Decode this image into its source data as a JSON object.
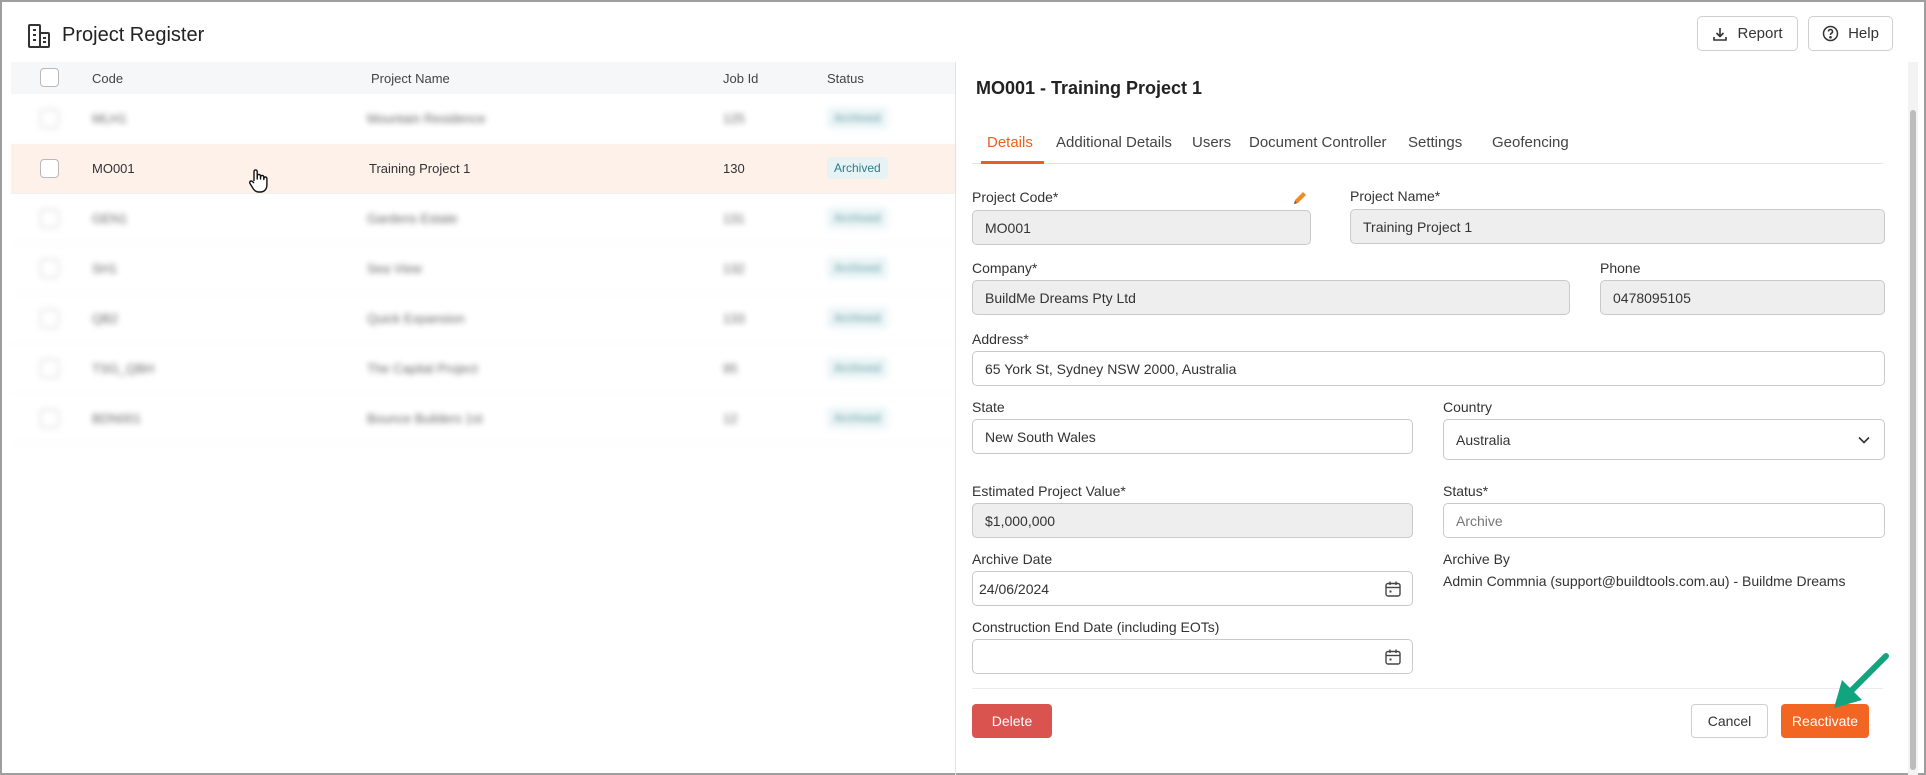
{
  "header": {
    "title": "Project Register",
    "report_label": "Report",
    "help_label": "Help",
    "icons": {
      "logo": "building-icon",
      "report": "download-icon",
      "help": "help-circle-icon"
    }
  },
  "list": {
    "columns": [
      "Code",
      "Project Name",
      "Job Id",
      "Status"
    ],
    "rows": [
      {
        "code": "MLH1",
        "name": "Mountain Residence",
        "job_id": "125",
        "status": "Archived",
        "blurred": true
      },
      {
        "code": "MO001",
        "name": "Training Project 1",
        "job_id": "130",
        "status": "Archived",
        "blurred": false,
        "selected": true
      },
      {
        "code": "GEN1",
        "name": "Gardens Estate",
        "job_id": "131",
        "status": "Archived",
        "blurred": true
      },
      {
        "code": "SH1",
        "name": "Sea View",
        "job_id": "132",
        "status": "Archived",
        "blurred": true
      },
      {
        "code": "QB2",
        "name": "Quick Expansion",
        "job_id": "133",
        "status": "Archived",
        "blurred": true
      },
      {
        "code": "TSG_QBH",
        "name": "The Capital Project",
        "job_id": "95",
        "status": "Archived",
        "blurred": true
      },
      {
        "code": "BDN001",
        "name": "Bounce Builders 1st",
        "job_id": "12",
        "status": "Archived",
        "blurred": true
      }
    ]
  },
  "panel": {
    "title": "MO001 - Training Project 1",
    "tabs": [
      "Details",
      "Additional Details",
      "Users",
      "Document Controller",
      "Settings",
      "Geofencing"
    ],
    "active_tab": "Details",
    "fields": {
      "project_code": {
        "label": "Project Code*",
        "value": "MO001"
      },
      "project_name": {
        "label": "Project Name*",
        "value": "Training Project 1"
      },
      "company": {
        "label": "Company*",
        "value": "BuildMe Dreams Pty Ltd"
      },
      "phone": {
        "label": "Phone",
        "value": "0478095105"
      },
      "address": {
        "label": "Address*",
        "value": "65 York St, Sydney NSW 2000, Australia"
      },
      "state": {
        "label": "State",
        "value": "New South Wales"
      },
      "country": {
        "label": "Country",
        "value": "Australia"
      },
      "estimated_value": {
        "label": "Estimated Project Value*",
        "value": "$1,000,000"
      },
      "status": {
        "label": "Status*",
        "value": "Archive"
      },
      "archive_date": {
        "label": "Archive Date",
        "value": "24/06/2024"
      },
      "archive_by": {
        "label": "Archive By",
        "value": "Admin Commnia (support@buildtools.com.au) - Buildme Dreams"
      },
      "construction_end": {
        "label": "Construction End Date (including EOTs)",
        "value": ""
      }
    },
    "buttons": {
      "delete": "Delete",
      "cancel": "Cancel",
      "reactivate": "Reactivate"
    }
  },
  "colors": {
    "accent": "#f26522",
    "danger": "#d9534f",
    "badge": "#2e7d87",
    "annotation_arrow": "#12a37f"
  }
}
